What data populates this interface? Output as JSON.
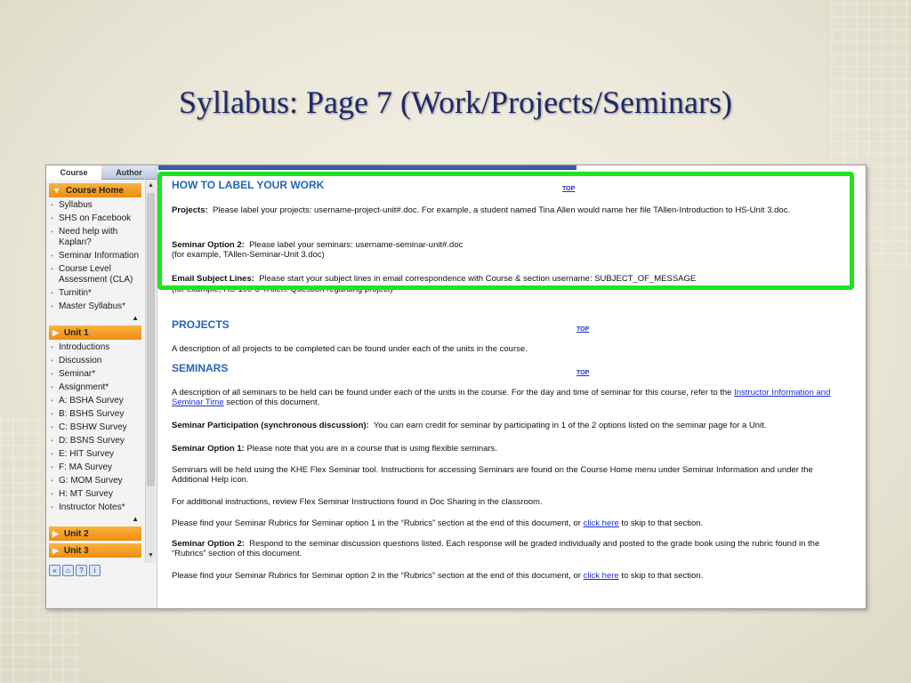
{
  "slide": {
    "title": "Syllabus: Page 7 (Work/Projects/Seminars)"
  },
  "nav": {
    "tabs": [
      "Course",
      "Author"
    ],
    "course_home_label": "Course Home",
    "course_home_items": [
      "Syllabus",
      "SHS on Facebook",
      "Need help with Kaplan?",
      "Seminar Information",
      "Course Level Assessment (CLA)",
      "Turnitin*",
      "Master Syllabus*"
    ],
    "unit1_label": "Unit 1",
    "unit1_items": [
      "Introductions",
      "Discussion",
      "Seminar*",
      "Assignment*",
      "A: BSHA Survey",
      "B: BSHS Survey",
      "C: BSHW Survey",
      "D: BSNS Survey",
      "E: HIT Survey",
      "F: MA Survey",
      "G: MOM Survey",
      "H: MT Survey",
      "Instructor Notes*"
    ],
    "unit2_label": "Unit 2",
    "unit3_label": "Unit 3"
  },
  "doc": {
    "top_link": "TOP",
    "how_to_label": {
      "heading": "HOW TO LABEL YOUR WORK",
      "projects_label": "Projects:",
      "projects_text": "Please label your projects: username-project-unit#.doc.  For example, a student named Tina Allen would name her file TAllen-Introduction to HS-Unit 3.doc.",
      "seminar2_label": "Seminar Option 2:",
      "seminar2_text": "Please label your seminars: username-seminar-unit#.doc",
      "seminar2_example": "(for example, TAllen-Seminar-Unit 3.doc)",
      "email_label": "Email Subject Lines:",
      "email_text": "Please start your subject lines in email correspondence with Course & section username: SUBJECT_OF_MESSAGE",
      "email_example": "(for example, HS-100-3-TAllen: Question regarding project)"
    },
    "projects": {
      "heading": "PROJECTS",
      "text": "A description of all projects to be completed can be found under each of the units in the course."
    },
    "seminars": {
      "heading": "SEMINARS",
      "intro_text": "A description of all seminars to be held can be found under each of the units in the course.  For the day and time of seminar for this course, refer to the",
      "intro_link": "Instructor Information and Seminar Time",
      "intro_tail": "section of this document.",
      "participation_label": "Seminar Participation (synchronous discussion):",
      "participation_text": "You can earn credit for seminar by participating in 1 of the 2 options listed on the seminar page for a Unit.",
      "option1_label": "Seminar Option 1:",
      "option1_text": "Please note that you are in a course that is using flexible seminars.",
      "flex_text": "Seminars will be held using the KHE Flex Seminar tool. Instructions for accessing Seminars are found on the Course Home menu under Seminar Information and under the Additional Help icon.",
      "additional_text": "For additional instructions, review Flex Seminar Instructions found in Doc Sharing in the classroom.",
      "rubric1_text": "Please find your Seminar Rubrics for Seminar option 1 in the “Rubrics” section at the end of this document, or",
      "click_here": "click here",
      "rubric_tail": "to skip to that section.",
      "option2_label": "Seminar Option 2:",
      "option2_text": "Respond to the seminar discussion questions listed. Each response will be graded individually and posted to the grade book using the rubric found in the “Rubrics” section of this document.",
      "rubric2_text": "Please find your Seminar Rubrics for Seminar option 2 in the “Rubrics” section at the end of this document, or"
    }
  },
  "colors": {
    "highlight": "#21e21f",
    "heading": "#2466b5",
    "nav_section": "#ef8d10",
    "title": "#1f2a6b"
  }
}
